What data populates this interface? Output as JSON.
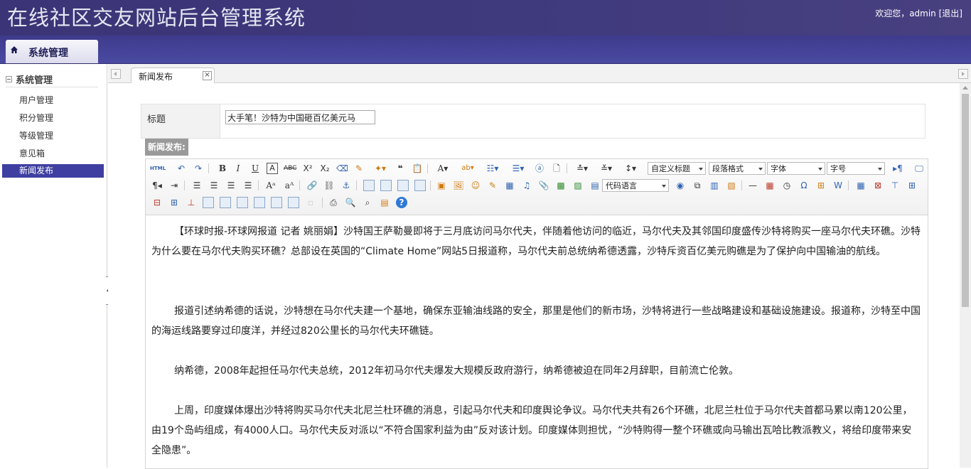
{
  "header": {
    "app_title": "在线社区交友网站后台管理系统",
    "welcome_text": "欢迎您，admin",
    "logout_label": "[退出]"
  },
  "nav": {
    "tab_label": "系统管理",
    "tab_icon": "home-icon"
  },
  "sidebar": {
    "section_title": "系统管理",
    "items": [
      {
        "label": "用户管理"
      },
      {
        "label": "积分管理"
      },
      {
        "label": "等级管理"
      },
      {
        "label": "意见箱"
      },
      {
        "label": "新闻发布",
        "active": true
      }
    ]
  },
  "tabs": [
    {
      "label": "新闻发布",
      "close": "×"
    }
  ],
  "form": {
    "title_label": "标题",
    "title_value": "大手笔！沙特为中国砸百亿美元马",
    "section_label": "新闻发布:"
  },
  "toolbar": {
    "html_label": "HTML",
    "custom_title": "自定义标题",
    "paragraph_format": "段落格式",
    "font_family": "字体",
    "font_size": "字号",
    "code_language": "代码语言"
  },
  "article": {
    "paragraphs": [
      "【环球时报-环球网报道 记者 姚丽娟】沙特国王萨勒曼即将于三月底访问马尔代夫，伴随着他访问的临近，马尔代夫及其邻国印度盛传沙特将购买一座马尔代夫环礁。沙特为什么要在马尔代夫购买环礁？总部设在英国的“Climate Home”网站5日报道称，马尔代夫前总统纳希德透露，沙特斥资百亿美元购礁是为了保护向中国输油的航线。",
      "报道引述纳希德的话说，沙特想在马尔代夫建一个基地，确保东亚输油线路的安全，那里是他们的新市场，沙特将进行一些战略建设和基础设施建设。报道称，沙特至中国的海运线路要穿过印度洋，并经过820公里长的马尔代夫环礁链。",
      "纳希德，2008年起担任马尔代夫总统，2012年初马尔代夫爆发大规模反政府游行，纳希德被迫在同年2月辞职，目前流亡伦敦。",
      "上周，印度媒体爆出沙特将购买马尔代夫北尼兰杜环礁的消息，引起马尔代夫和印度舆论争议。马尔代夫共有26个环礁，北尼兰杜位于马尔代夫首都马累以南120公里，由19个岛屿组成，有4000人口。马尔代夫反对派以“不符合国家利益为由”反对该计划。印度媒体则担忧，“沙特购得一整个环礁或向马输出瓦哈比教派教义，将给印度带来安全隐患”。"
    ]
  }
}
